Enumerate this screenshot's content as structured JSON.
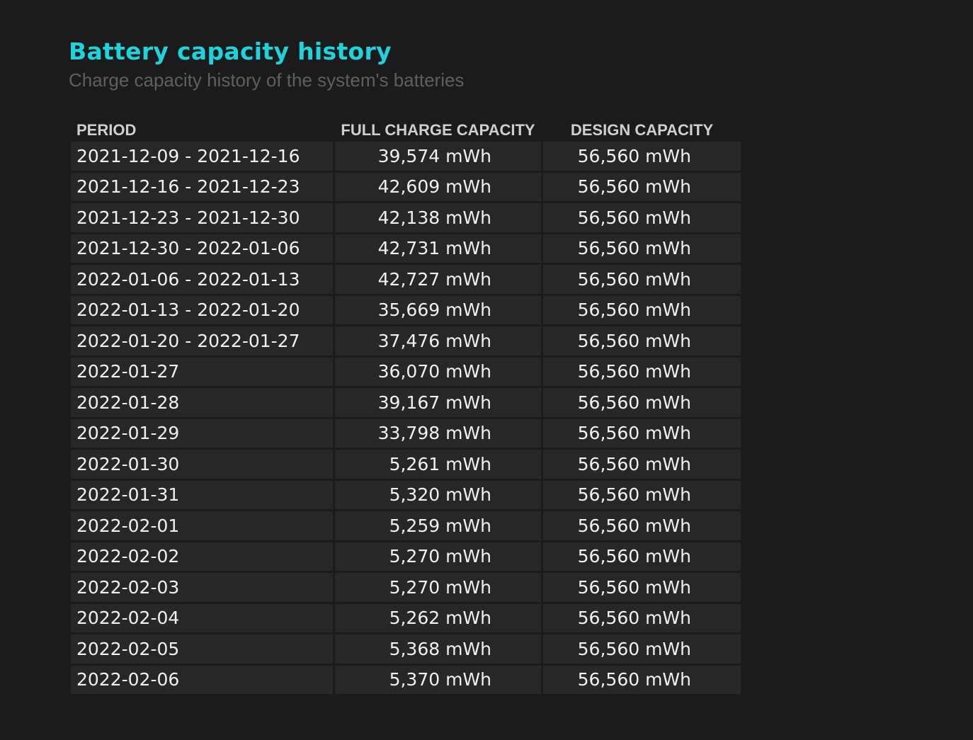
{
  "report": {
    "title": "Battery capacity history",
    "subtitle": "Charge capacity history of the system's batteries"
  },
  "table": {
    "headers": [
      "PERIOD",
      "FULL CHARGE CAPACITY",
      "DESIGN CAPACITY"
    ],
    "rows": [
      {
        "period": "2021-12-09 - 2021-12-16",
        "full": "39,574 mWh",
        "design": "56,560 mWh"
      },
      {
        "period": "2021-12-16 - 2021-12-23",
        "full": "42,609 mWh",
        "design": "56,560 mWh"
      },
      {
        "period": "2021-12-23 - 2021-12-30",
        "full": "42,138 mWh",
        "design": "56,560 mWh"
      },
      {
        "period": "2021-12-30 - 2022-01-06",
        "full": "42,731 mWh",
        "design": "56,560 mWh"
      },
      {
        "period": "2022-01-06 - 2022-01-13",
        "full": "42,727 mWh",
        "design": "56,560 mWh"
      },
      {
        "period": "2022-01-13 - 2022-01-20",
        "full": "35,669 mWh",
        "design": "56,560 mWh"
      },
      {
        "period": "2022-01-20 - 2022-01-27",
        "full": "37,476 mWh",
        "design": "56,560 mWh"
      },
      {
        "period": "2022-01-27",
        "full": "36,070 mWh",
        "design": "56,560 mWh"
      },
      {
        "period": "2022-01-28",
        "full": "39,167 mWh",
        "design": "56,560 mWh"
      },
      {
        "period": "2022-01-29",
        "full": "33,798 mWh",
        "design": "56,560 mWh"
      },
      {
        "period": "2022-01-30",
        "full": "5,261 mWh",
        "design": "56,560 mWh"
      },
      {
        "period": "2022-01-31",
        "full": "5,320 mWh",
        "design": "56,560 mWh"
      },
      {
        "period": "2022-02-01",
        "full": "5,259 mWh",
        "design": "56,560 mWh"
      },
      {
        "period": "2022-02-02",
        "full": "5,270 mWh",
        "design": "56,560 mWh"
      },
      {
        "period": "2022-02-03",
        "full": "5,270 mWh",
        "design": "56,560 mWh"
      },
      {
        "period": "2022-02-04",
        "full": "5,262 mWh",
        "design": "56,560 mWh"
      },
      {
        "period": "2022-02-05",
        "full": "5,368 mWh",
        "design": "56,560 mWh"
      },
      {
        "period": "2022-02-06",
        "full": "5,370 mWh",
        "design": "56,560 mWh"
      }
    ]
  },
  "colors": {
    "background": "#1b1b1b",
    "title": "#1fd2dc",
    "subtitle": "#5f5f5f",
    "cell": "#272727"
  }
}
